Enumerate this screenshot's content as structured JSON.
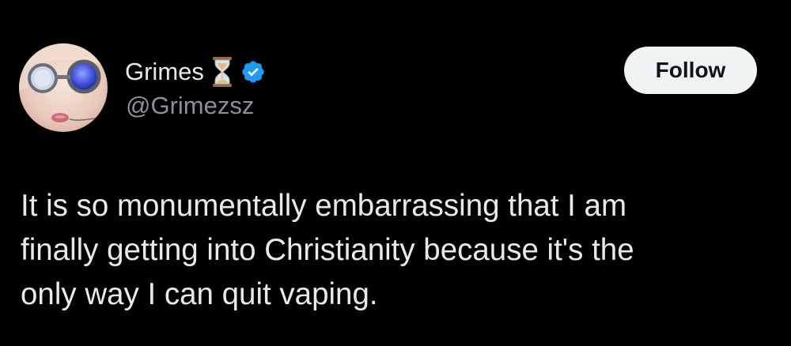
{
  "author": {
    "display_name": "Grimes",
    "handle": "@Grimezsz",
    "name_emoji": "hourglass-icon",
    "verified_badge": "verified-badge-icon"
  },
  "actions": {
    "follow_label": "Follow"
  },
  "tweet": {
    "text": "It is so monumentally embarrassing that I am\nfinally getting into Christianity because it's the\nonly way I can quit vaping."
  },
  "colors": {
    "background": "#000000",
    "primary_text": "#e7e9ea",
    "secondary_text": "#8b9196",
    "verified_blue": "#1d9bf0",
    "follow_button_bg": "#eff3f4",
    "follow_button_text": "#0f1419"
  }
}
